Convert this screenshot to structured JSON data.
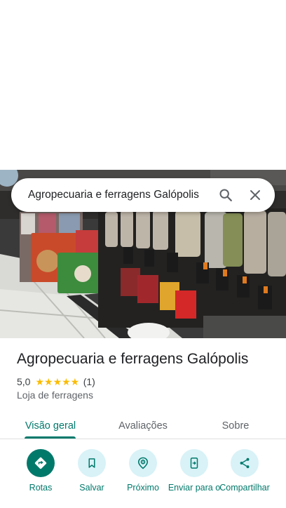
{
  "search": {
    "query": "Agropecuaria e ferragens Galópolis"
  },
  "place": {
    "name": "Agropecuaria e ferragens Galópolis",
    "rating": "5,0",
    "stars": "★★★★★",
    "review_count": "(1)",
    "category": "Loja de ferragens"
  },
  "tabs": [
    {
      "label": "Visão geral",
      "active": true
    },
    {
      "label": "Avaliações",
      "active": false
    },
    {
      "label": "Sobre",
      "active": false
    }
  ],
  "actions": [
    {
      "label": "Rotas",
      "icon": "directions-icon"
    },
    {
      "label": "Salvar",
      "icon": "bookmark-icon"
    },
    {
      "label": "Próximo",
      "icon": "nearby-icon"
    },
    {
      "label": "Enviar para o",
      "icon": "send-to-phone-icon"
    },
    {
      "label": "Compartilhar",
      "icon": "share-icon"
    }
  ],
  "colors": {
    "accent": "#00796b",
    "chip": "#d8f2f7",
    "star": "#fbbc04"
  }
}
